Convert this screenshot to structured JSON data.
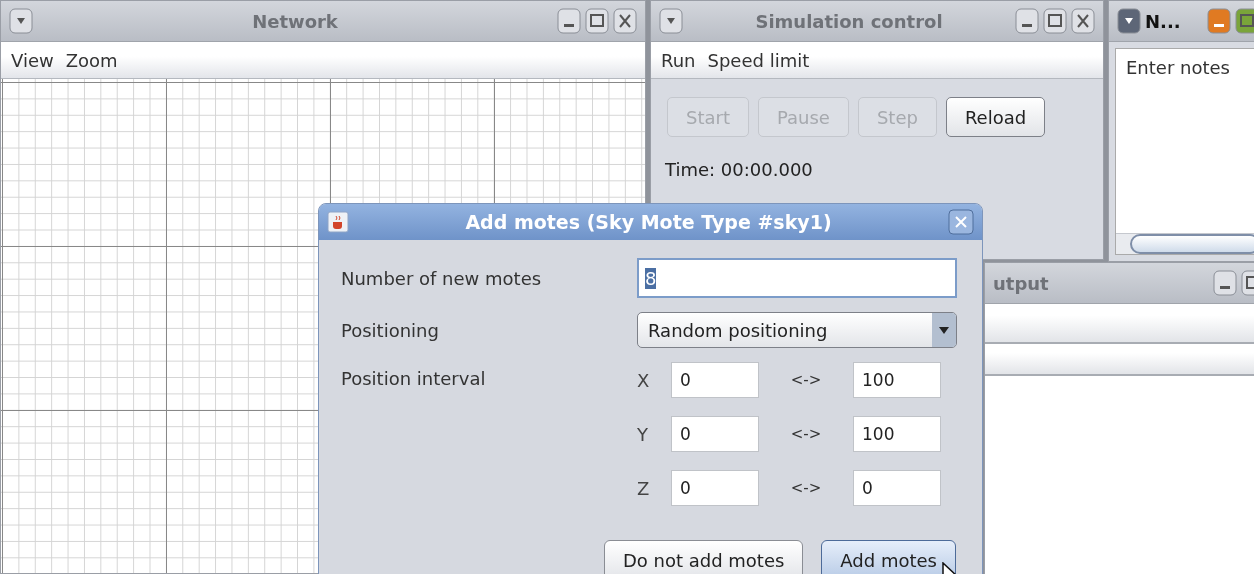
{
  "network_window": {
    "title": "Network",
    "menu": [
      "View",
      "Zoom"
    ]
  },
  "simulation_window": {
    "title": "Simulation control",
    "menu": [
      "Run",
      "Speed limit"
    ],
    "buttons": [
      {
        "label": "Start",
        "disabled": true
      },
      {
        "label": "Pause",
        "disabled": true
      },
      {
        "label": "Step",
        "disabled": true
      },
      {
        "label": "Reload",
        "disabled": false
      }
    ],
    "time": "Time: 00:00.000"
  },
  "notes_window": {
    "title": "N...",
    "text": "Enter notes"
  },
  "output_window": {
    "title": "utput"
  },
  "dialog": {
    "title": "Add motes (Sky Mote Type #sky1)",
    "number_label": "Number of new motes",
    "number_value": "8",
    "number_selected": true,
    "positioning_label": "Positioning",
    "positioning_value": "Random positioning",
    "interval_label": "Position interval",
    "intervals": [
      {
        "axis": "X",
        "min": "0",
        "separator": "<->",
        "max": "100"
      },
      {
        "axis": "Y",
        "min": "0",
        "separator": "<->",
        "max": "100"
      },
      {
        "axis": "Z",
        "min": "0",
        "separator": "<->",
        "max": "0"
      }
    ],
    "buttons": [
      {
        "label": "Do not add motes",
        "focused": false
      },
      {
        "label": "Add motes",
        "focused": true
      }
    ]
  }
}
